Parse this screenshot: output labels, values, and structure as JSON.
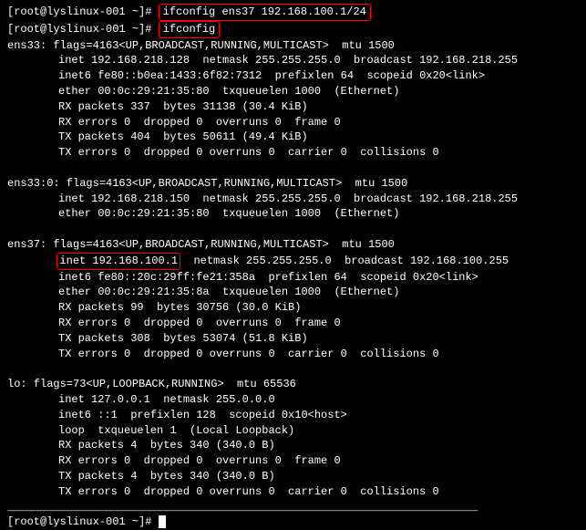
{
  "prompt1": "[root@lyslinux-001 ~]#",
  "prompt2": "[root@lyslinux-001 ~]#",
  "prompt3": "[root@lyslinux-001 ~]# ",
  "cmd1": "ifconfig ens37 192.168.100.1/24",
  "cmd2": "ifconfig",
  "ens33": {
    "header": "ens33: flags=4163<UP,BROADCAST,RUNNING,MULTICAST>  mtu 1500",
    "inet": "inet 192.168.218.128  netmask 255.255.255.0  broadcast 192.168.218.255",
    "inet6": "inet6 fe80::b0ea:1433:6f82:7312  prefixlen 64  scopeid 0x20<link>",
    "ether": "ether 00:0c:29:21:35:80  txqueuelen 1000  (Ethernet)",
    "rxp": "RX packets 337  bytes 31138 (30.4 KiB)",
    "rxe": "RX errors 0  dropped 0  overruns 0  frame 0",
    "txp": "TX packets 404  bytes 50611 (49.4 KiB)",
    "txe": "TX errors 0  dropped 0 overruns 0  carrier 0  collisions 0"
  },
  "ens33_0": {
    "header": "ens33:0: flags=4163<UP,BROADCAST,RUNNING,MULTICAST>  mtu 1500",
    "inet": "inet 192.168.218.150  netmask 255.255.255.0  broadcast 192.168.218.255",
    "ether": "ether 00:0c:29:21:35:80  txqueuelen 1000  (Ethernet)"
  },
  "ens37": {
    "header": "ens37: flags=4163<UP,BROADCAST,RUNNING,MULTICAST>  mtu 1500",
    "inet_addr": "inet 192.168.100.1",
    "inet_rest": "  netmask 255.255.255.0  broadcast 192.168.100.255",
    "inet6": "inet6 fe80::20c:29ff:fe21:358a  prefixlen 64  scopeid 0x20<link>",
    "ether": "ether 00:0c:29:21:35:8a  txqueuelen 1000  (Ethernet)",
    "rxp": "RX packets 99  bytes 30756 (30.0 KiB)",
    "rxe": "RX errors 0  dropped 0  overruns 0  frame 0",
    "txp": "TX packets 308  bytes 53074 (51.8 KiB)",
    "txe": "TX errors 0  dropped 0 overruns 0  carrier 0  collisions 0"
  },
  "lo": {
    "header": "lo: flags=73<UP,LOOPBACK,RUNNING>  mtu 65536",
    "inet": "inet 127.0.0.1  netmask 255.0.0.0",
    "inet6": "inet6 ::1  prefixlen 128  scopeid 0x10<host>",
    "loop": "loop  txqueuelen 1  (Local Loopback)",
    "rxp": "RX packets 4  bytes 340 (340.0 B)",
    "rxe": "RX errors 0  dropped 0  overruns 0  frame 0",
    "txp": "TX packets 4  bytes 340 (340.0 B)",
    "txe": "TX errors 0  dropped 0 overruns 0  carrier 0  collisions 0"
  },
  "hr": "_____________________________________________________________________________"
}
